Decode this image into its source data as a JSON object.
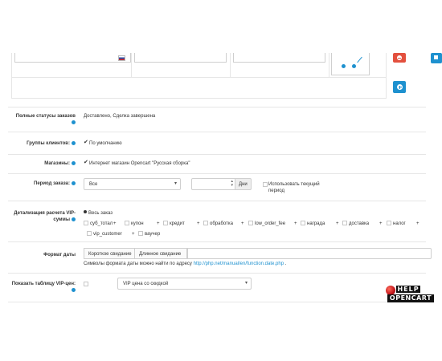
{
  "form": {
    "full_statuses": {
      "label": "Полные статусы заказов",
      "value": "Доставлено, Сделка завершена"
    },
    "customer_groups": {
      "label": "Группы клиентов:",
      "value": "По умолчанию"
    },
    "stores": {
      "label": "Магазины:",
      "value": "Интернет магазин Opencart \"Русская сборка\""
    },
    "order_period": {
      "label": "Период заказа:",
      "select_value": "Все",
      "days_addon": "Дни",
      "use_current_label": "Использовать текущий период"
    },
    "vip_detail": {
      "label": "Детализация расчета VIP-суммы",
      "radio_label": "Весь заказ",
      "totals": [
        "суб_тотал",
        "купон",
        "кредит",
        "обработка",
        "low_order_fee",
        "награда",
        "доставка",
        "налог",
        "vip_customer",
        "ваучер"
      ]
    },
    "date_format": {
      "label": "Формат даты",
      "short_tab": "Короткое свидание",
      "long_tab": "Длинное свидание",
      "hint_prefix": "Символы формата даты можно найти по адресу ",
      "hint_link": "http://php.net/manual/en/function.date.php",
      "hint_suffix": " ."
    },
    "vip_table": {
      "label": "Показать таблицу VIP-цен:",
      "select_value": "VIP цена со скидкой"
    }
  },
  "watermark": {
    "line1": "HELP",
    "line2": "OPENCART"
  },
  "colors": {
    "primary": "#1e91cf",
    "danger": "#e3503e",
    "link": "#1e91cf"
  }
}
